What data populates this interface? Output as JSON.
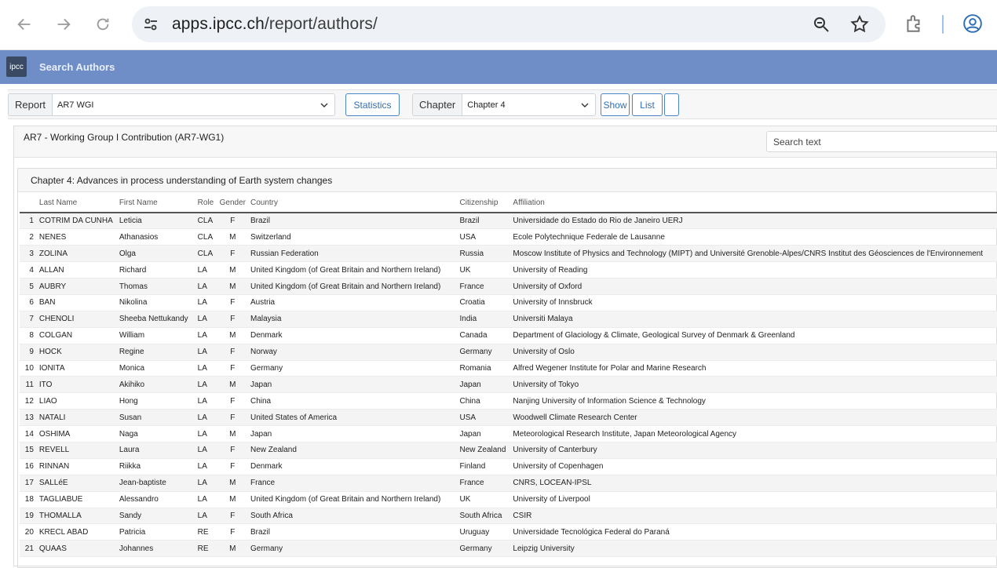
{
  "browser": {
    "url_host": "apps.ipcc.ch",
    "url_path": "/report/authors/"
  },
  "app": {
    "logo_text": "ipcc",
    "title": "Search Authors"
  },
  "toolbar": {
    "report_label": "Report",
    "report_value": "AR7 WGI",
    "statistics_label": "Statistics",
    "chapter_label": "Chapter",
    "chapter_value": "Chapter 4",
    "show_label": "Show",
    "list_label": "List"
  },
  "panel": {
    "title": "AR7 - Working Group I Contribution (AR7-WG1)",
    "search_placeholder": "Search text",
    "chapter_title": "Chapter 4: Advances in process understanding of Earth system changes"
  },
  "table": {
    "headers": [
      "",
      "Last Name",
      "First Name",
      "Role",
      "Gender",
      "Country",
      "Citizenship",
      "Affiliation"
    ],
    "rows": [
      [
        "1",
        "COTRIM DA CUNHA",
        "Leticia",
        "CLA",
        "F",
        "Brazil",
        "Brazil",
        "Universidade do Estado do Rio de Janeiro UERJ"
      ],
      [
        "2",
        "NENES",
        "Athanasios",
        "CLA",
        "M",
        "Switzerland",
        "USA",
        "Ecole Polytechnique Federale de Lausanne"
      ],
      [
        "3",
        "ZOLINA",
        "Olga",
        "CLA",
        "F",
        "Russian Federation",
        "Russia",
        "Moscow Institute of Physics and Technology (MIPT) and Université Grenoble-Alpes/CNRS Institut des Géosciences de l'Environnement"
      ],
      [
        "4",
        "ALLAN",
        "Richard",
        "LA",
        "M",
        "United Kingdom (of Great Britain and Northern Ireland)",
        "UK",
        "University of Reading"
      ],
      [
        "5",
        "AUBRY",
        "Thomas",
        "LA",
        "M",
        "United Kingdom (of Great Britain and Northern Ireland)",
        "France",
        "University of Oxford"
      ],
      [
        "6",
        "BAN",
        "Nikolina",
        "LA",
        "F",
        "Austria",
        "Croatia",
        "University of Innsbruck"
      ],
      [
        "7",
        "CHENOLI",
        "Sheeba Nettukandy",
        "LA",
        "F",
        "Malaysia",
        "India",
        "Universiti Malaya"
      ],
      [
        "8",
        "COLGAN",
        "William",
        "LA",
        "M",
        "Denmark",
        "Canada",
        "Department of Glaciology & Climate, Geological Survey of Denmark & Greenland"
      ],
      [
        "9",
        "HOCK",
        "Regine",
        "LA",
        "F",
        "Norway",
        "Germany",
        "University of Oslo"
      ],
      [
        "10",
        "IONITA",
        "Monica",
        "LA",
        "F",
        "Germany",
        "Romania",
        "Alfred Wegener Institute for Polar and Marine Research"
      ],
      [
        "11",
        "ITO",
        "Akihiko",
        "LA",
        "M",
        "Japan",
        "Japan",
        "University of Tokyo"
      ],
      [
        "12",
        "LIAO",
        "Hong",
        "LA",
        "F",
        "China",
        "China",
        "Nanjing University of Information Science & Technology"
      ],
      [
        "13",
        "NATALI",
        "Susan",
        "LA",
        "F",
        "United States of America",
        "USA",
        "Woodwell Climate Research Center"
      ],
      [
        "14",
        "OSHIMA",
        "Naga",
        "LA",
        "M",
        "Japan",
        "Japan",
        "Meteorological Research Institute, Japan Meteorological Agency"
      ],
      [
        "15",
        "REVELL",
        "Laura",
        "LA",
        "F",
        "New Zealand",
        "New Zealand",
        "University of Canterbury"
      ],
      [
        "16",
        "RINNAN",
        "Riikka",
        "LA",
        "F",
        "Denmark",
        "Finland",
        "University of Copenhagen"
      ],
      [
        "17",
        "SALLéE",
        "Jean-baptiste",
        "LA",
        "M",
        "France",
        "France",
        "CNRS, LOCEAN-IPSL"
      ],
      [
        "18",
        "TAGLIABUE",
        "Alessandro",
        "LA",
        "M",
        "United Kingdom (of Great Britain and Northern Ireland)",
        "UK",
        "University of Liverpool"
      ],
      [
        "19",
        "THOMALLA",
        "Sandy",
        "LA",
        "F",
        "South Africa",
        "South Africa",
        "CSIR"
      ],
      [
        "20",
        "KRECL ABAD",
        "Patricia",
        "RE",
        "F",
        "Brazil",
        "Uruguay",
        "Universidade Tecnológica Federal do Paraná"
      ],
      [
        "21",
        "QUAAS",
        "Johannes",
        "RE",
        "M",
        "Germany",
        "Germany",
        "Leipzig University"
      ]
    ]
  },
  "colors": {
    "appbar": "#6f8ec7",
    "button_border": "#4a86c8"
  }
}
